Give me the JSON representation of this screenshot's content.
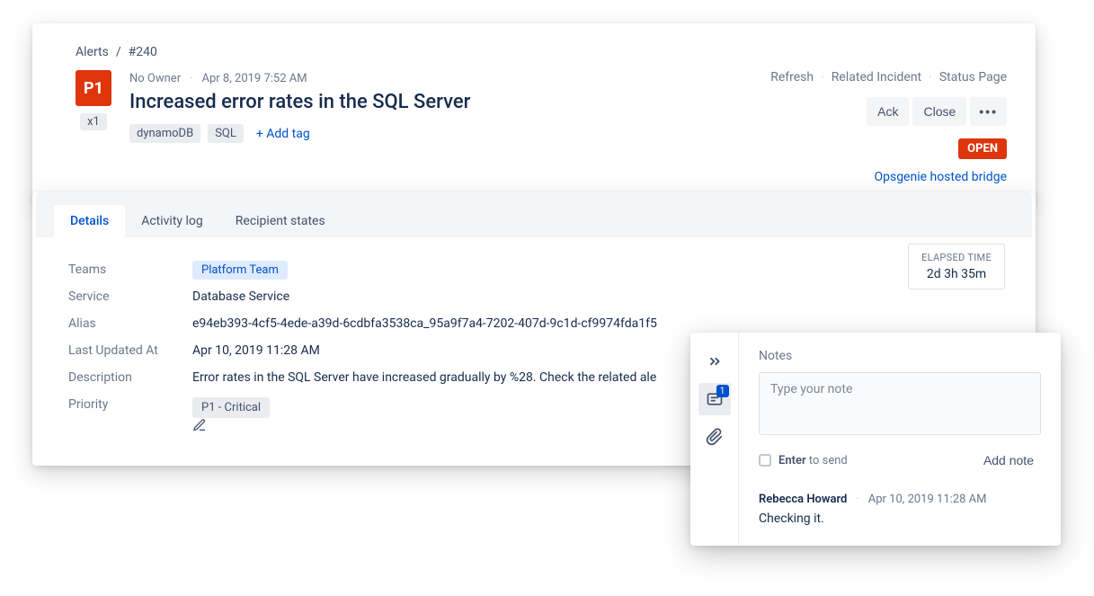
{
  "breadcrumb": {
    "root": "Alerts",
    "id": "#240",
    "sep": "/"
  },
  "header": {
    "priority": "P1",
    "count": "x1",
    "owner": "No Owner",
    "timestamp": "Apr 8, 2019 7:52 AM",
    "title": "Increased error rates in the SQL Server",
    "tags": [
      "dynamoDB",
      "SQL"
    ],
    "add_tag": "+ Add tag",
    "top_links": [
      "Refresh",
      "Related Incident",
      "Status Page"
    ],
    "actions": {
      "ack": "Ack",
      "close": "Close",
      "more": "•••"
    },
    "status": "OPEN",
    "hosted_link": "Opsgenie hosted bridge"
  },
  "tabs": [
    "Details",
    "Activity log",
    "Recipient states"
  ],
  "details": {
    "labels": {
      "teams": "Teams",
      "service": "Service",
      "alias": "Alias",
      "updated": "Last Updated At",
      "description": "Description",
      "priority": "Priority"
    },
    "teams": "Platform Team",
    "service": "Database Service",
    "alias": "e94eb393-4cf5-4ede-a39d-6cdbfa3538ca_95a9f7a4-7202-407d-9c1d-cf9974fda1f5",
    "updated": "Apr 10, 2019 11:28 AM",
    "description": "Error rates in the SQL Server have increased gradually by %28. Check the related ale",
    "priority": "P1 - Critical"
  },
  "elapsed": {
    "label": "ELAPSED TIME",
    "value": "2d   3h   35m"
  },
  "notes": {
    "title": "Notes",
    "placeholder": "Type your note",
    "enter_bold": "Enter",
    "enter_rest": " to send",
    "add_btn": "Add note",
    "badge": "1",
    "entry": {
      "author": "Rebecca Howard",
      "time": "Apr 10, 2019 11:28 AM",
      "text": "Checking it."
    }
  }
}
